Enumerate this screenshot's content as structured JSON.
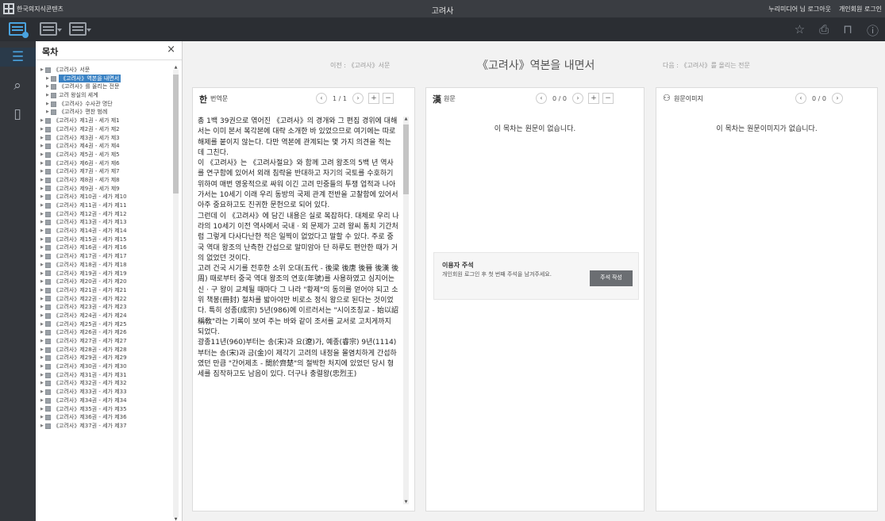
{
  "app": {
    "logo_text": "한국의지식콘텐츠",
    "title": "고려사",
    "user_links": [
      "누리미디어 님 로그아웃",
      "개인회원 로그인"
    ]
  },
  "toolbar": {
    "right_icons": [
      "star-icon",
      "print-icon",
      "bookmark-icon",
      "info-icon"
    ]
  },
  "rail": {
    "icons": [
      "toc-list-icon",
      "search-icon",
      "bookmark-icon"
    ]
  },
  "toc": {
    "title": "목차",
    "close": "×",
    "items": [
      {
        "label": "《고려사》서문",
        "level": 0
      },
      {
        "label": "《고려사》역본을 내면서",
        "level": 1,
        "selected": true
      },
      {
        "label": "《고려사》를 올리는 전문",
        "level": 1
      },
      {
        "label": "고려 왕실의 세계",
        "level": 1
      },
      {
        "label": "《고려사》수사관 명단",
        "level": 1
      },
      {
        "label": "《고려사》편찬 범례",
        "level": 1
      },
      {
        "label": "《고려사》제1권 - 세가 제1",
        "level": 0
      },
      {
        "label": "《고려사》제2권 - 세가 제2",
        "level": 0
      },
      {
        "label": "《고려사》제3권 - 세가 제3",
        "level": 0
      },
      {
        "label": "《고려사》제4권 - 세가 제4",
        "level": 0
      },
      {
        "label": "《고려사》제5권 - 세가 제5",
        "level": 0
      },
      {
        "label": "《고려사》제6권 - 세가 제6",
        "level": 0
      },
      {
        "label": "《고려사》제7권 - 세가 제7",
        "level": 0
      },
      {
        "label": "《고려사》제8권 - 세가 제8",
        "level": 0
      },
      {
        "label": "《고려사》제9권 - 세가 제9",
        "level": 0
      },
      {
        "label": "《고려사》제10권 - 세가 제10",
        "level": 0
      },
      {
        "label": "《고려사》제11권 - 세가 제11",
        "level": 0
      },
      {
        "label": "《고려사》제12권 - 세가 제12",
        "level": 0
      },
      {
        "label": "《고려사》제13권 - 세가 제13",
        "level": 0
      },
      {
        "label": "《고려사》제14권 - 세가 제14",
        "level": 0
      },
      {
        "label": "《고려사》제15권 - 세가 제15",
        "level": 0
      },
      {
        "label": "《고려사》제16권 - 세가 제16",
        "level": 0
      },
      {
        "label": "《고려사》제17권 - 세가 제17",
        "level": 0
      },
      {
        "label": "《고려사》제18권 - 세가 제18",
        "level": 0
      },
      {
        "label": "《고려사》제19권 - 세가 제19",
        "level": 0
      },
      {
        "label": "《고려사》제20권 - 세가 제20",
        "level": 0
      },
      {
        "label": "《고려사》제21권 - 세가 제21",
        "level": 0
      },
      {
        "label": "《고려사》제22권 - 세가 제22",
        "level": 0
      },
      {
        "label": "《고려사》제23권 - 세가 제23",
        "level": 0
      },
      {
        "label": "《고려사》제24권 - 세가 제24",
        "level": 0
      },
      {
        "label": "《고려사》제25권 - 세가 제25",
        "level": 0
      },
      {
        "label": "《고려사》제26권 - 세가 제26",
        "level": 0
      },
      {
        "label": "《고려사》제27권 - 세가 제27",
        "level": 0
      },
      {
        "label": "《고려사》제28권 - 세가 제28",
        "level": 0
      },
      {
        "label": "《고려사》제29권 - 세가 제29",
        "level": 0
      },
      {
        "label": "《고려사》제30권 - 세가 제30",
        "level": 0
      },
      {
        "label": "《고려사》제31권 - 세가 제31",
        "level": 0
      },
      {
        "label": "《고려사》제32권 - 세가 제32",
        "level": 0
      },
      {
        "label": "《고려사》제33권 - 세가 제33",
        "level": 0
      },
      {
        "label": "《고려사》제34권 - 세가 제34",
        "level": 0
      },
      {
        "label": "《고려사》제35권 - 세가 제35",
        "level": 0
      },
      {
        "label": "《고려사》제36권 - 세가 제36",
        "level": 0
      },
      {
        "label": "《고려사》제37권 - 세가 제37",
        "level": 0
      }
    ]
  },
  "nav": {
    "prev": "이전 : 《고려사》서문",
    "current": "《고려사》역본을 내면서",
    "next": "다음 : 《고려사》를 올리는 전문"
  },
  "translation": {
    "icon_glyph": "한",
    "title": "번역문",
    "pager": "1 / 1",
    "paragraphs": [
      "총 1백 39권으로 엮어진 《고려사》의 경개와 그 편집 경위에 대해서는 이미 본서 복각본에 대략 소개한 바 있었으므로 여기에는 따로 해제를 붙이지 않는다. 다만 역본에 관계되는 몇 가지 의견을 적는 데 그친다.",
      "이 《고려사》는 《고려사절요》와 함께 고려 왕조의 5백 년 역사를 연구함에 있어서 외래 침략을 반대하고 자기의 국토를 수호하기 위하여 매번 영웅적으로 싸워 이긴 고려 민중들의 투쟁 업적과 나아가서는 10세기 이래 우리 동방의 국제 관계 전반을 고찰함에 있어서 아주 중요하고도 진귀한 문헌으로 되어 있다.",
      "그런데 이 《고려사》에 담긴 내용은 실로 복잡하다. 대체로 우리 나라의 10세기 이전 역사에서 국내 · 외 문제가 고려 왕씨 통치 기간처럼 그렇게 다사다난한 적은 일찍이 없었다고 말할 수 있다. 주로 중국 역대 왕조의 난측한 간섭으로 말미암아 단 하루도 편안한 때가 거의 없었던 것이다.",
      "고려 건국 시기를 전후한 소위 오대(五代 - 後梁 後唐 後晉 後漢 後周) 때로부터 중국 역대 왕조의 연호(年號)를 사용하였고 심지어는 신 · 구 왕이 교체될 때마다 그 나라 \"황제\"의 동의를 얻어야 되고 소위 책봉(冊封) 절차를 밟아야만 비로소 정식 왕으로 된다는 것이었다. 특히 성종(成宗) 5년(986)에 이르러서는 \"시이조칭교 - 始以詔稱敎\"라는 기록이 보여 주는 바와 같이 조서를 교서로 고치게까지 되었다.",
      "광종11년(960)부터는 송(宋)과 요(遼)가, 예종(睿宗) 9년(1114)부터는 송(宋)과 금(金)이 제각기 고려의 내정을 몰염치하게 간섭하였던 만큼 \"간어제초 - 間於齊楚\"의 절박한 처지에 있었던 당시 형세를 짐작하고도 남음이 있다. 더구나 충렬왕(忠烈王)"
    ]
  },
  "original": {
    "icon_glyph": "漢",
    "title": "원문",
    "pager": "0 / 0",
    "empty_message": "이 목차는 원문이 없습니다."
  },
  "user_note": {
    "title": "이용자 주석",
    "description": "개인회원 로그인 후 첫 번째 주석을 남겨주세요.",
    "button": "주석 작성"
  },
  "image_panel": {
    "title": "원문이미지",
    "pager": "0 / 0",
    "empty_message": "이 목차는 원문이미지가 없습니다."
  },
  "colors": {
    "titlebar": "#3a3d42",
    "toolbar": "#2b2e33",
    "accent": "#4aa3df",
    "selection": "#3a82c4"
  }
}
